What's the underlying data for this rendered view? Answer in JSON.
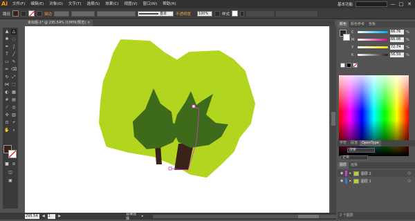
{
  "app": {
    "logo": "Ai",
    "workspace": "基本功能",
    "window_buttons": [
      "—",
      "□",
      "✕"
    ]
  },
  "menu": [
    "文件(F)",
    "编辑(E)",
    "对象(O)",
    "文字(T)",
    "选择(S)",
    "效果(C)",
    "视图(V)",
    "窗口(W)",
    "帮助(H)"
  ],
  "control_bar": {
    "path_label": "路径",
    "stroke_label": "描边",
    "stroke_style": "基本",
    "opacity_label": "不透明度",
    "opacity_value": "100%",
    "style_label": "样式"
  },
  "document_tab": {
    "title": "未标题-1* @ 295.54% (CMYK/预览)",
    "close": "×"
  },
  "status_bar": {
    "zoom": "295.54",
    "page": "1",
    "tool_label": "直接选择"
  },
  "color_panel": {
    "tabs": [
      "颜色",
      "颜色参考",
      "色板"
    ],
    "channels": [
      {
        "label": "C",
        "value": "66.76",
        "unit": "%",
        "color": "#00a8e8"
      },
      {
        "label": "M",
        "value": "66.06",
        "unit": "%",
        "color": "#e0008a"
      },
      {
        "label": "Y",
        "value": "72.74",
        "unit": "%",
        "color": "#f0e000"
      },
      {
        "label": "K",
        "value": "56.59",
        "unit": "%",
        "color": "#222222"
      }
    ],
    "fill_color": "#3b2219",
    "hex": "3B2219"
  },
  "layers_panel": {
    "tabs": [
      "图层",
      "画板"
    ],
    "sub_tabs": [
      "字符",
      "段落",
      "OpenType"
    ],
    "search_label": "搜索",
    "mode_label": "正常",
    "layers": [
      {
        "name": "图层 2",
        "color": "#d23cd2",
        "selected": true
      },
      {
        "name": "图层 1",
        "color": "#3c78d2",
        "selected": false
      }
    ],
    "footer": "2 个图层"
  },
  "colors": {
    "bg_dark": "#323232",
    "accent": "#f5a03c",
    "light_green": "#b2d51f",
    "dark_green": "#3e6a1c",
    "trunk": "#3b2219",
    "selection_path": "#d23cd2"
  }
}
